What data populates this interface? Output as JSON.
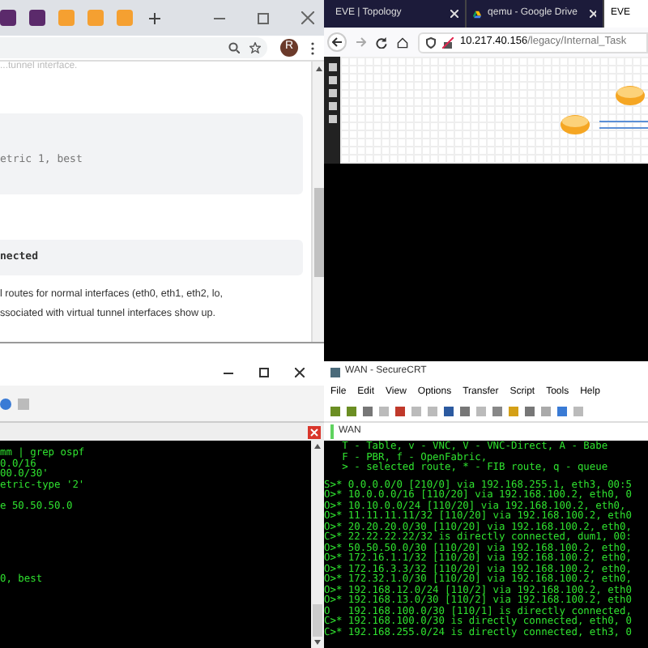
{
  "browser_left": {
    "content": {
      "top_line": "...tunnel interface.",
      "code_block_1": "etric 1, best",
      "code_block_2": "nected",
      "paragraph": [
        "l routes for normal interfaces (eth0, eth1, eth2, lo,",
        "ssociated with virtual tunnel interfaces show up."
      ]
    },
    "avatar": "R"
  },
  "browser_right": {
    "tabs": [
      {
        "label": "EVE | Topology",
        "selected": false
      },
      {
        "label": "qemu - Google Drive",
        "selected": false
      },
      {
        "label": "EVE",
        "selected": true
      }
    ],
    "url_host": "10.217.40.156",
    "url_path": "/legacy/Internal_Task"
  },
  "terminal_left": {
    "blocks": [
      [
        "mm | grep ospf",
        "0.0/16",
        "00.0/30'",
        "etric-type '2'"
      ],
      [
        "e 50.50.50.0"
      ],
      [
        "0, best"
      ]
    ]
  },
  "terminal_right": {
    "title": "WAN - SecureCRT",
    "menu": [
      "File",
      "Edit",
      "View",
      "Options",
      "Transfer",
      "Script",
      "Tools",
      "Help"
    ],
    "tab": "WAN",
    "blocks": [
      [
        "   T - Table, v - VNC, V - VNC-Direct, A - Babe",
        "   F - PBR, f - OpenFabric,",
        "   > - selected route, * - FIB route, q - queue"
      ],
      [
        "S>* 0.0.0.0/0 [210/0] via 192.168.255.1, eth3, 00:5",
        "O>* 10.0.0.0/16 [110/20] via 192.168.100.2, eth0, 0",
        "O>* 10.10.0.0/24 [110/20] via 192.168.100.2, eth0,",
        "O>* 11.11.11.11/32 [110/20] via 192.168.100.2, eth0",
        "O>* 20.20.20.0/30 [110/20] via 192.168.100.2, eth0,",
        "C>* 22.22.22.22/32 is directly connected, dum1, 00:",
        "O>* 50.50.50.0/30 [110/20] via 192.168.100.2, eth0,",
        "O>* 172.16.1.1/32 [110/20] via 192.168.100.2, eth0,",
        "O>* 172.16.3.3/32 [110/20] via 192.168.100.2, eth0,",
        "O>* 172.32.1.0/30 [110/20] via 192.168.100.2, eth0,",
        "O>* 192.168.12.0/24 [110/2] via 192.168.100.2, eth0",
        "O>* 192.168.13.0/30 [110/2] via 192.168.100.2, eth0",
        "O   192.168.100.0/30 [110/1] is directly connected,",
        "C>* 192.168.100.0/30 is directly connected, eth0, 0",
        "C>* 192.168.255.0/24 is directly connected, eth3, 0"
      ]
    ]
  }
}
